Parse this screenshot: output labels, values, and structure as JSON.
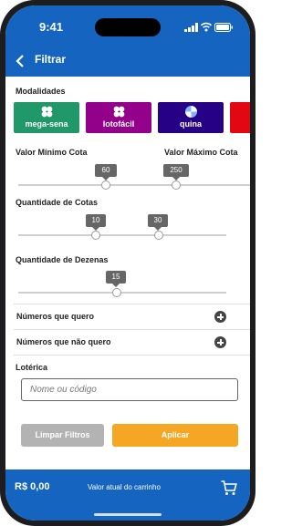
{
  "status_bar": {
    "time": "9:41"
  },
  "header": {
    "title": "Filtrar"
  },
  "modalidades": {
    "label": "Modalidades",
    "items": [
      {
        "label": "mega-sena",
        "color": "#209869"
      },
      {
        "label": "lotofácil",
        "color": "#930089"
      },
      {
        "label": "quina",
        "color": "#260085"
      },
      {
        "label": "",
        "color": "#e30613"
      }
    ]
  },
  "cota": {
    "min_label": "Valor Mínimo Cota",
    "max_label": "Valor Máximo Cota",
    "min_value": "60",
    "max_value": "250"
  },
  "quantidade_cotas": {
    "label": "Quantidade de Cotas",
    "min_value": "10",
    "max_value": "30"
  },
  "quantidade_dezenas": {
    "label": "Quantidade de Dezenas",
    "value": "15"
  },
  "numeros_quero": {
    "label": "Números que quero"
  },
  "numeros_nao_quero": {
    "label": "Números que não quero"
  },
  "loterica": {
    "label": "Lotérica",
    "placeholder": "Nome ou código"
  },
  "buttons": {
    "clear": "Limpar Filtros",
    "apply": "Aplicar"
  },
  "colors": {
    "primary": "#1565c0",
    "apply": "#f5a623",
    "clear": "#b3b3b3"
  },
  "footer": {
    "price": "R$ 0,00",
    "cart_text": "Valor atual do carrinho"
  }
}
